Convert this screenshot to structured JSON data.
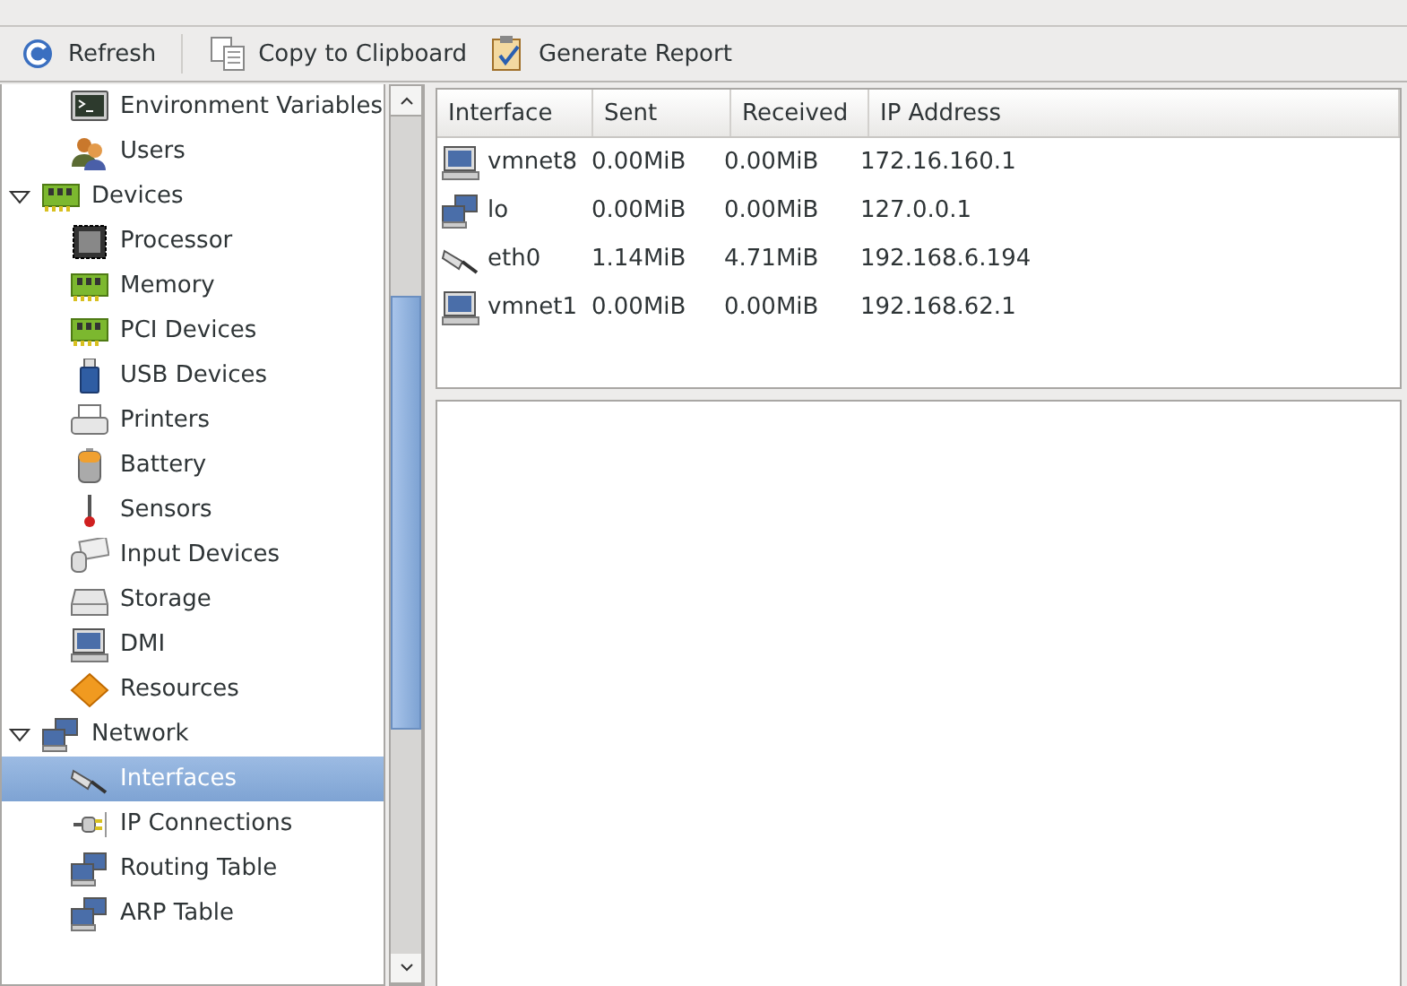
{
  "toolbar": [
    {
      "label": "Refresh"
    },
    {
      "label": "Copy to Clipboard"
    },
    {
      "label": "Generate Report"
    }
  ],
  "sidebar": {
    "items": [
      {
        "children": [
          {
            "label": "Environment Variables",
            "selected": false
          },
          {
            "label": "Users",
            "selected": false
          }
        ]
      },
      {
        "label": "Devices",
        "expanded": true,
        "selected": false,
        "children": [
          {
            "label": "Processor",
            "selected": false
          },
          {
            "label": "Memory",
            "selected": false
          },
          {
            "label": "PCI Devices",
            "selected": false
          },
          {
            "label": "USB Devices",
            "selected": false
          },
          {
            "label": "Printers",
            "selected": false
          },
          {
            "label": "Battery",
            "selected": false
          },
          {
            "label": "Sensors",
            "selected": false
          },
          {
            "label": "Input Devices",
            "selected": false
          },
          {
            "label": "Storage",
            "selected": false
          },
          {
            "label": "DMI",
            "selected": false
          },
          {
            "label": "Resources",
            "selected": false
          }
        ]
      },
      {
        "label": "Network",
        "expanded": true,
        "selected": false,
        "children": [
          {
            "label": "Interfaces",
            "selected": true
          },
          {
            "label": "IP Connections",
            "selected": false
          },
          {
            "label": "Routing Table",
            "selected": false
          },
          {
            "label": "ARP Table",
            "selected": false
          }
        ]
      }
    ]
  },
  "table": {
    "columns": [
      "Interface",
      "Sent",
      "Received",
      "IP Address"
    ],
    "rows": [
      {
        "kind": "monitor",
        "cells": [
          "vmnet8",
          "0.00MiB",
          "0.00MiB",
          "172.16.160.1"
        ]
      },
      {
        "kind": "network",
        "cells": [
          "lo",
          "0.00MiB",
          "0.00MiB",
          "127.0.0.1"
        ]
      },
      {
        "kind": "cable",
        "cells": [
          "eth0",
          "1.14MiB",
          "4.71MiB",
          "192.168.6.194"
        ]
      },
      {
        "kind": "monitor",
        "cells": [
          "vmnet1",
          "0.00MiB",
          "0.00MiB",
          "192.168.62.1"
        ]
      }
    ]
  }
}
